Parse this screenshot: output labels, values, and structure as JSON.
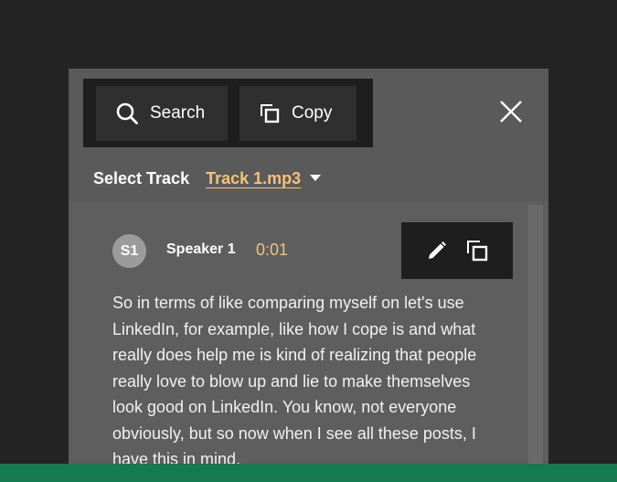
{
  "toolbar": {
    "search_label": "Search",
    "copy_label": "Copy"
  },
  "track": {
    "label": "Select Track",
    "selected": "Track 1.mp3"
  },
  "entry": {
    "avatar_initials": "S1",
    "speaker": "Speaker 1",
    "timestamp": "0:01",
    "text": "So in terms of like comparing myself on let's use LinkedIn, for example, like how I cope is and what really does help me is kind of realizing that people really love to blow up and lie to make themselves look good on LinkedIn. You know, not everyone obviously, but so now when I see all these posts, I have this in mind."
  },
  "icons": {
    "search": "search-icon",
    "copy": "copy-icon",
    "close": "close-icon",
    "dropdown": "caret-down-icon",
    "edit": "pencil-icon"
  },
  "colors": {
    "background": "#242424",
    "panel": "#5a5a5a",
    "toolbar": "#1e1e1e",
    "accent": "#f2c27a",
    "avatar": "#9b9b9b",
    "footer": "#137a52"
  }
}
